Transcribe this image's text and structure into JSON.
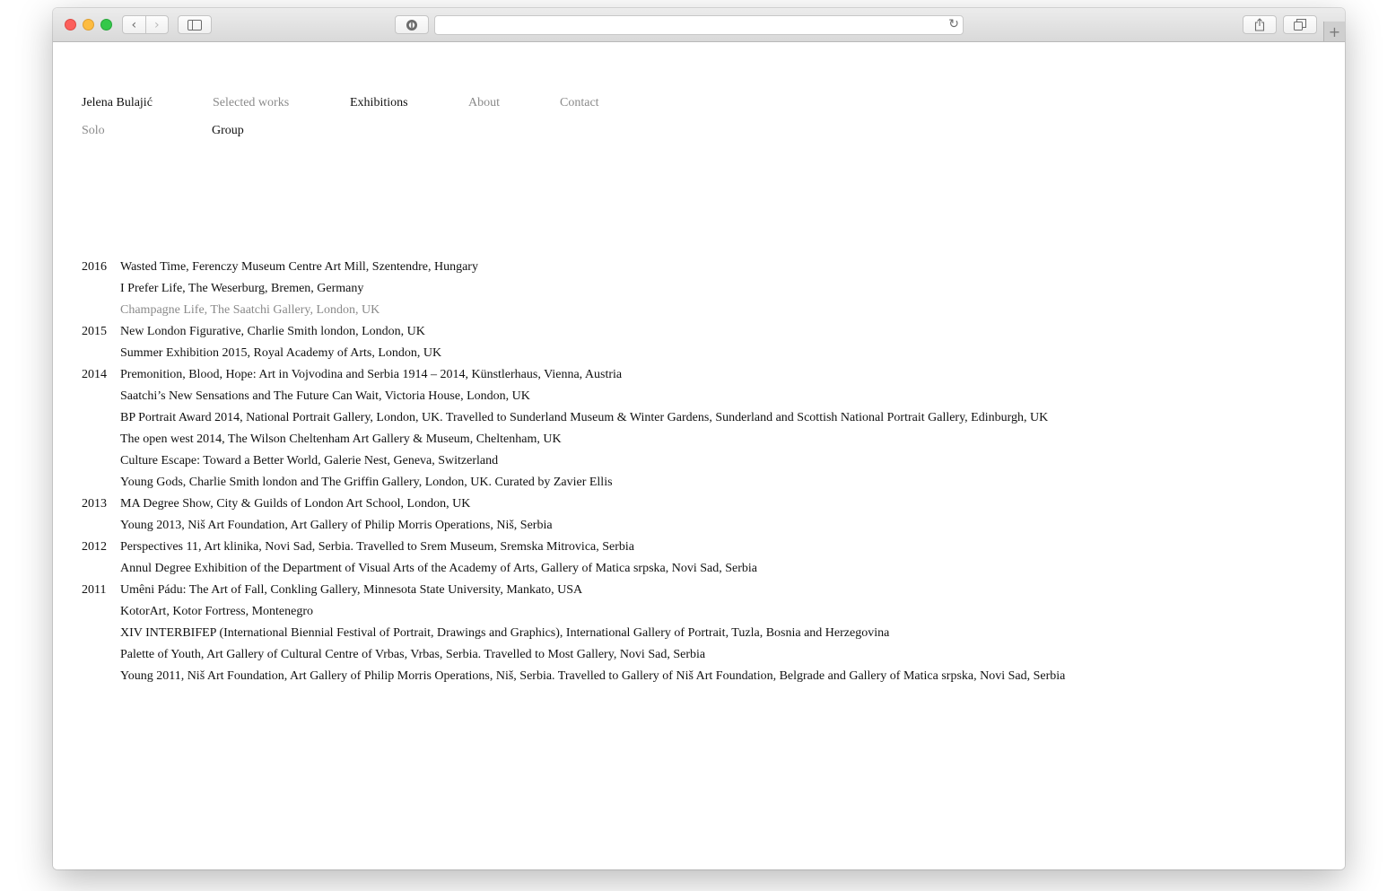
{
  "browser": {
    "back_glyph": "‹",
    "forward_glyph": "›",
    "sidebar_glyph": "▭",
    "privacy_glyph": "◐",
    "reload_glyph": "↻",
    "share_glyph": "⇪",
    "tabs_glyph": "❐",
    "new_tab_glyph": "+"
  },
  "site": {
    "artist_name": "Jelena Bulajić",
    "nav": {
      "selected_works": "Selected works",
      "exhibitions": "Exhibitions",
      "about": "About",
      "contact": "Contact"
    },
    "subnav": {
      "solo": "Solo",
      "group": "Group"
    }
  },
  "exhibitions": [
    {
      "year": "2016",
      "text": "Wasted Time, Ferenczy Museum Centre Art Mill, Szentendre, Hungary"
    },
    {
      "year": "",
      "text": "I Prefer Life, The Weserburg, Bremen, Germany"
    },
    {
      "year": "",
      "text": "Champagne Life, The Saatchi Gallery, London, UK",
      "muted": true
    },
    {
      "year": "2015",
      "text": "New London Figurative, Charlie Smith london, London, UK"
    },
    {
      "year": "",
      "text": "Summer Exhibition 2015, Royal Academy of Arts, London, UK"
    },
    {
      "year": "2014",
      "text": "Premonition, Blood, Hope: Art in Vojvodina and Serbia 1914 – 2014, Künstlerhaus, Vienna, Austria"
    },
    {
      "year": "",
      "text": "Saatchi’s New Sensations and The Future Can Wait, Victoria House, London, UK"
    },
    {
      "year": "",
      "text": "BP Portrait Award 2014, National Portrait Gallery, London, UK. Travelled to Sunderland Museum & Winter Gardens, Sunderland and Scottish National Portrait Gallery, Edinburgh, UK"
    },
    {
      "year": "",
      "text": "The open west 2014, The Wilson Cheltenham Art Gallery & Museum, Cheltenham, UK"
    },
    {
      "year": "",
      "text": "Culture Escape: Toward a Better World, Galerie Nest, Geneva, Switzerland"
    },
    {
      "year": "",
      "text": "Young Gods, Charlie Smith london and The Griffin Gallery, London, UK. Curated by Zavier Ellis"
    },
    {
      "year": "2013",
      "text": "MA Degree Show, City & Guilds of London Art School, London, UK"
    },
    {
      "year": "",
      "text": "Young 2013, Niš Art Foundation, Art Gallery of Philip Morris Operations, Niš, Serbia"
    },
    {
      "year": "2012",
      "text": "Perspectives 11, Art klinika, Novi Sad, Serbia. Travelled to Srem Museum, Sremska Mitrovica, Serbia"
    },
    {
      "year": "",
      "text": "Annul Degree Exhibition of the Department of Visual Arts of the Academy of Arts, Gallery of Matica srpska, Novi Sad, Serbia"
    },
    {
      "year": "2011",
      "text": "Umêni Pádu: The Art of Fall, Conkling Gallery, Minnesota State University, Mankato, USA"
    },
    {
      "year": "",
      "text": "KotorArt, Kotor Fortress, Montenegro"
    },
    {
      "year": "",
      "text": "XIV INTERBIFEP (International Biennial Festival of Portrait, Drawings and Graphics), International Gallery of Portrait, Tuzla, Bosnia and Herzegovina"
    },
    {
      "year": "",
      "text": "Palette of Youth, Art Gallery of Cultural Centre of Vrbas, Vrbas, Serbia. Travelled to Most Gallery, Novi Sad, Serbia"
    },
    {
      "year": "",
      "text": "Young 2011, Niš Art Foundation, Art Gallery of Philip Morris Operations, Niš, Serbia. Travelled to Gallery of Niš Art Foundation, Belgrade and Gallery of Matica srpska, Novi Sad, Serbia"
    }
  ]
}
